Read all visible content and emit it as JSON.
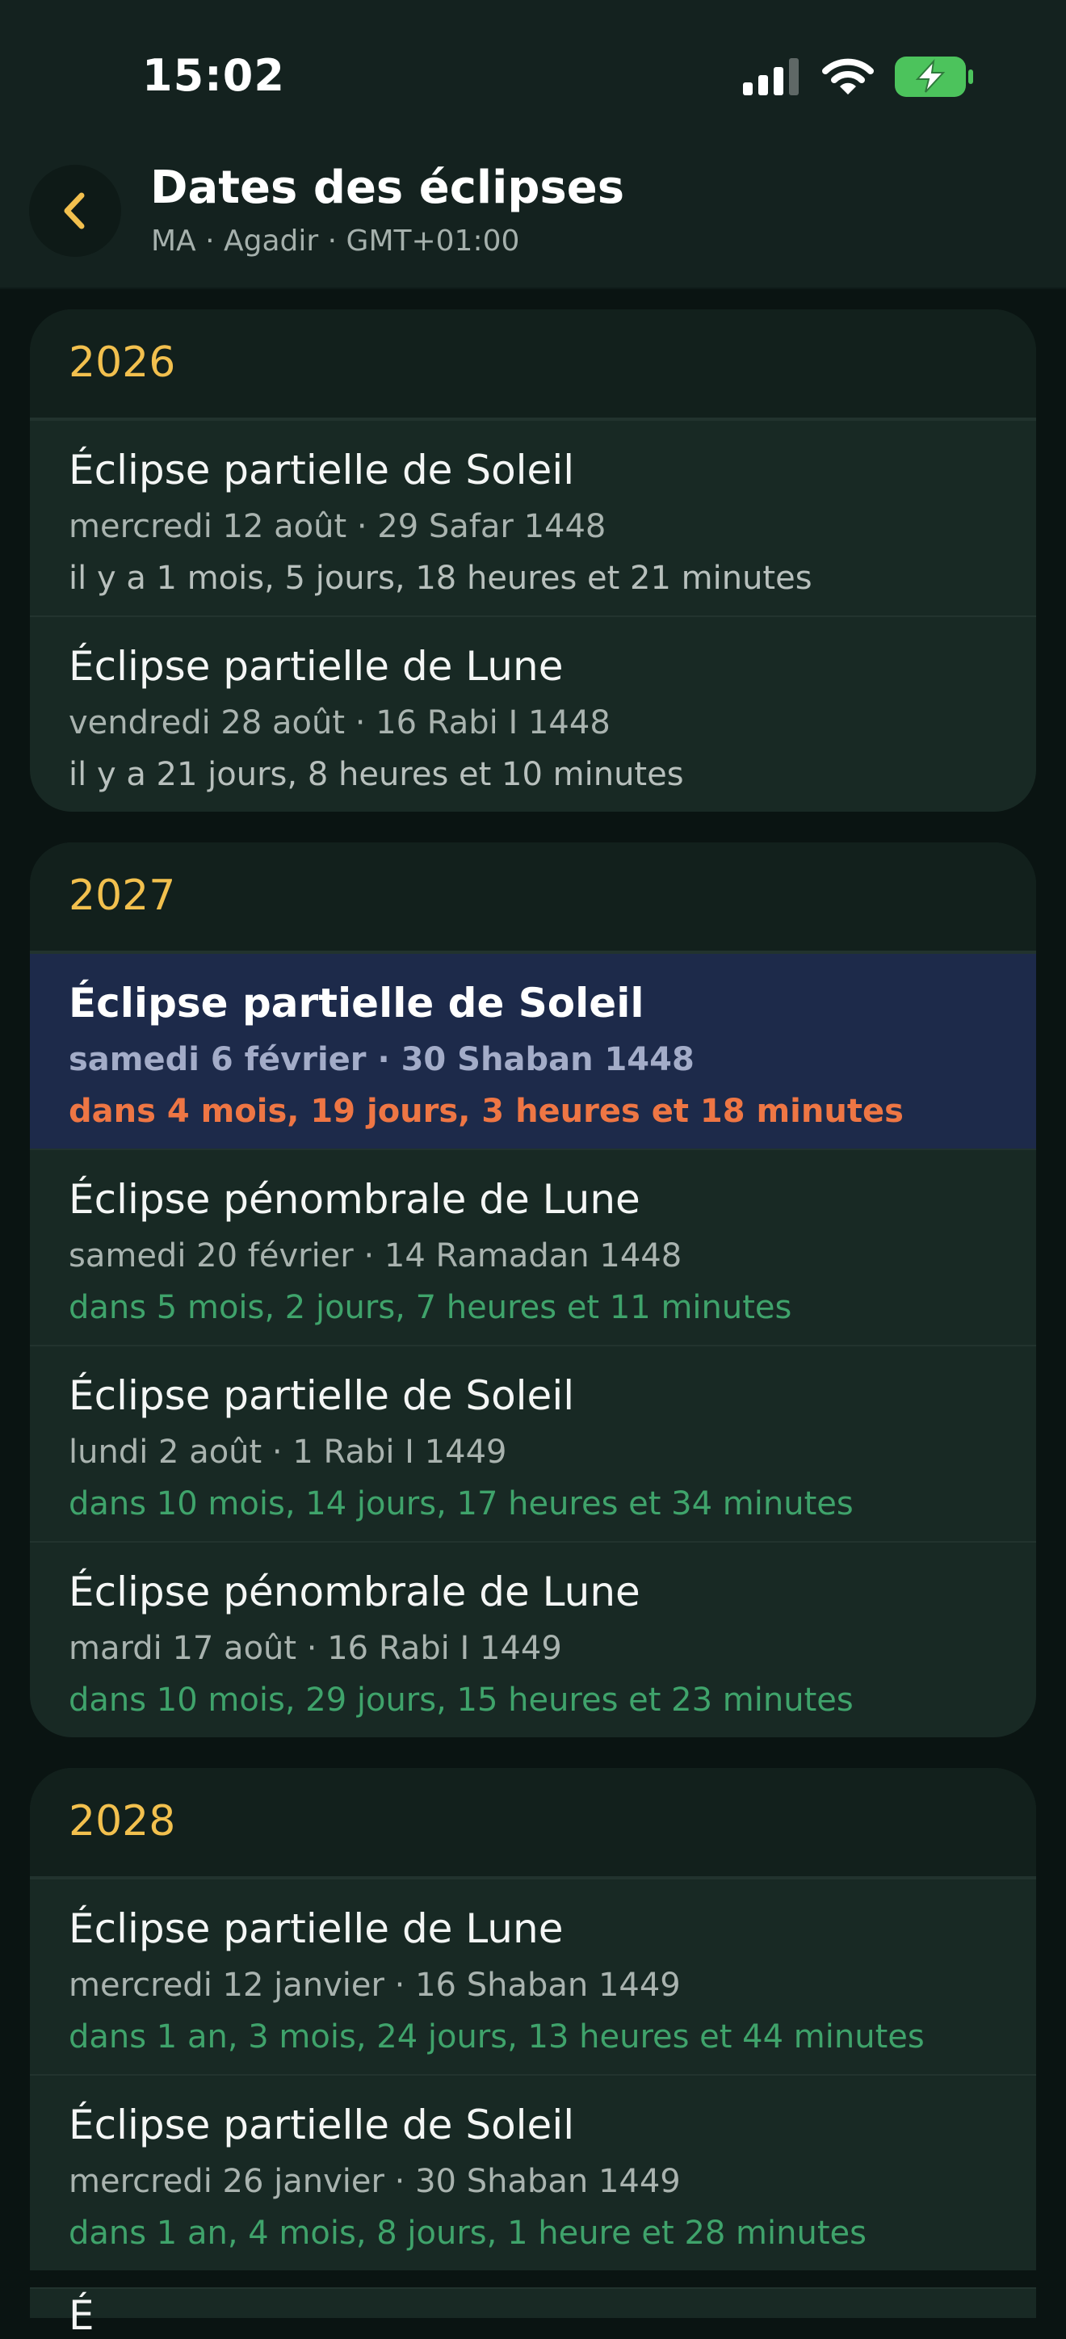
{
  "status": {
    "time": "15:02"
  },
  "header": {
    "title": "Dates des éclipses",
    "subtitle": "MA · Agadir · GMT+01:00"
  },
  "icons": {
    "back": "chevron-left-icon",
    "signal": "cellular-signal-icon",
    "wifi": "wifi-icon",
    "battery": "battery-charging-icon"
  },
  "colors": {
    "year": "#f2c04e",
    "future_relative": "#3fa36b",
    "highlight_relative": "#ee7644",
    "highlight_bg": "#1d2a4a",
    "battery": "#4cc35c"
  },
  "years": [
    {
      "year": "2026",
      "events": [
        {
          "title": "Éclipse partielle de Soleil",
          "date": "mercredi 12 août · 29 Safar 1448",
          "relative": "il y a 1 mois, 5 jours, 18 heures et 21 minutes"
        },
        {
          "title": "Éclipse partielle de Lune",
          "date": "vendredi 28 août · 16 Rabi I 1448",
          "relative": "il y a 21 jours, 8 heures et 10 minutes"
        }
      ]
    },
    {
      "year": "2027",
      "events": [
        {
          "title": "Éclipse partielle de Soleil",
          "date": "samedi 6 février · 30 Shaban 1448",
          "relative": "dans 4 mois, 19 jours, 3 heures et 18 minutes"
        },
        {
          "title": "Éclipse pénombrale de Lune",
          "date": "samedi 20 février · 14 Ramadan 1448",
          "relative": "dans 5 mois, 2 jours, 7 heures et 11 minutes"
        },
        {
          "title": "Éclipse partielle de Soleil",
          "date": "lundi 2 août · 1 Rabi I 1449",
          "relative": "dans 10 mois, 14 jours, 17 heures et 34 minutes"
        },
        {
          "title": "Éclipse pénombrale de Lune",
          "date": "mardi 17 août · 16 Rabi I 1449",
          "relative": "dans 10 mois, 29 jours, 15 heures et 23 minutes"
        }
      ]
    },
    {
      "year": "2028",
      "events": [
        {
          "title": "Éclipse partielle de Lune",
          "date": "mercredi 12 janvier · 16 Shaban 1449",
          "relative": "dans 1 an, 3 mois, 24 jours, 13 heures et 44 minutes"
        },
        {
          "title": "Éclipse partielle de Soleil",
          "date": "mercredi 26 janvier · 30 Shaban 1449",
          "relative": "dans 1 an, 4 mois, 8 jours, 1 heure et 28 minutes"
        }
      ],
      "peek_text": "É"
    }
  ]
}
